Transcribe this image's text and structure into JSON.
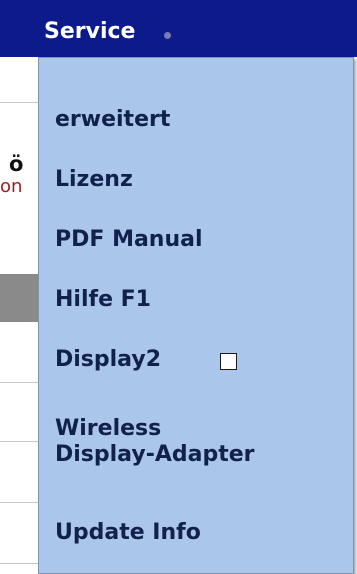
{
  "menu": {
    "title": "Service",
    "items": [
      {
        "label": "erweitert"
      },
      {
        "label": "Lizenz"
      },
      {
        "label": "PDF Manual"
      },
      {
        "label": "Hilfe F1"
      },
      {
        "label": "Display2",
        "checked": false
      },
      {
        "label": "Wireless"
      },
      {
        "label": "Display-Adapter"
      },
      {
        "label": "Update Info"
      }
    ]
  },
  "background": {
    "fragment1": "ö",
    "fragment2": "on"
  },
  "colors": {
    "menubar": "#0d1a8c",
    "dropdown": "#aac6ea",
    "text": "#11214a"
  }
}
